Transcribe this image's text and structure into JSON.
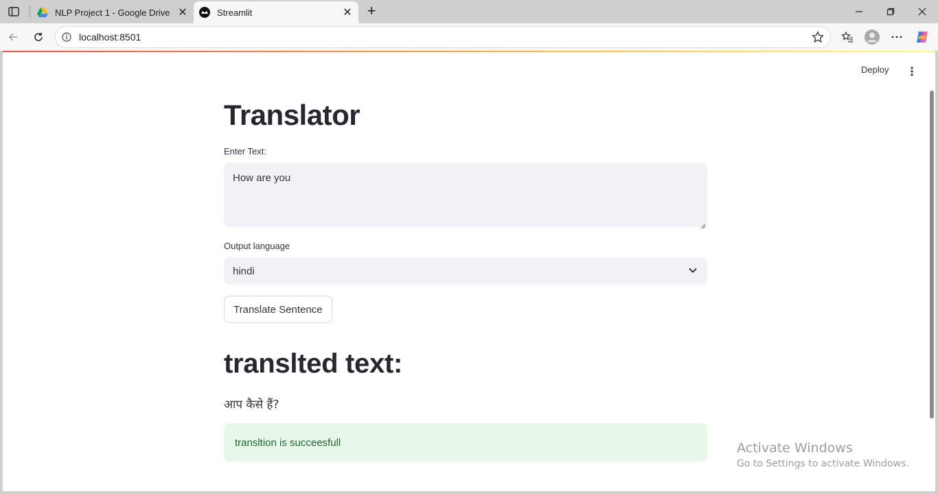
{
  "browser": {
    "tabs": [
      {
        "label": "NLP Project 1 - Google Drive",
        "active": false,
        "favicon": "google-drive-icon"
      },
      {
        "label": "Streamlit",
        "active": true,
        "favicon": "streamlit-icon"
      }
    ],
    "address": "localhost:8501"
  },
  "app": {
    "deploy_label": "Deploy",
    "title": "Translator",
    "input_label": "Enter Text:",
    "input_value": "How are you",
    "language_label": "Output language",
    "language_value": "hindi",
    "button_label": "Translate Sentence",
    "output_heading": "translted text:",
    "output_text": "आप कैसे हैं?",
    "success_message": "transltion is succeesfull",
    "success_color": "#17692f",
    "accent_color": "#ff4b4b"
  },
  "watermark": {
    "line1": "Activate Windows",
    "line2": "Go to Settings to activate Windows."
  }
}
